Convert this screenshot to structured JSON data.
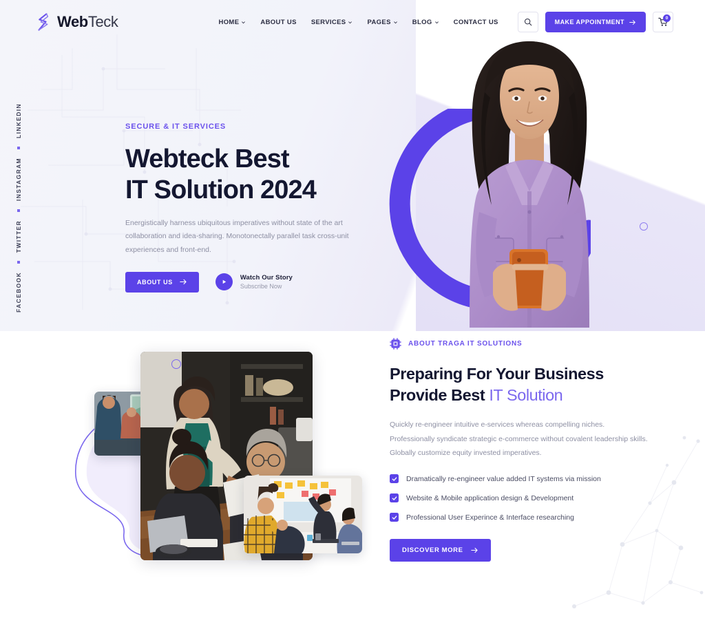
{
  "brand": {
    "name_bold": "Web",
    "name_light": "Teck",
    "logo_icon": "webteck-s-monogram"
  },
  "colors": {
    "accent": "#5b42e8",
    "accent_light": "#7b68ee",
    "heading": "#141731",
    "body_text": "#8d8fa3",
    "hero_bg": "#f4f5fa"
  },
  "header": {
    "nav_items": [
      {
        "label": "HOME",
        "has_dropdown": true
      },
      {
        "label": "ABOUT US",
        "has_dropdown": false
      },
      {
        "label": "SERVICES",
        "has_dropdown": true
      },
      {
        "label": "PAGES",
        "has_dropdown": true
      },
      {
        "label": "BLOG",
        "has_dropdown": true
      },
      {
        "label": "CONTACT US",
        "has_dropdown": false
      }
    ],
    "search_icon": "search-icon",
    "appointment_label": "MAKE APPOINTMENT",
    "cart_icon": "shopping-cart-icon",
    "cart_count": "0"
  },
  "social_rail": [
    {
      "label": "LINKEDIN"
    },
    {
      "label": "INSTAGRAM"
    },
    {
      "label": "TWITTER"
    },
    {
      "label": "FACEBOOK"
    }
  ],
  "hero": {
    "eyebrow": "SECURE & IT SERVICES",
    "title_line1": "Webteck Best",
    "title_line2": "IT Solution 2024",
    "paragraph": "Energistically harness ubiquitous imperatives without state of the art collaboration and idea-sharing. Monotonectally parallel task cross-unit experiences and front-end.",
    "primary_button": "ABOUT US",
    "video_title": "Watch Our Story",
    "video_subtitle": "Subscribe Now",
    "play_icon": "play-icon",
    "image_alt": "smiling-woman-holding-phone"
  },
  "about": {
    "eyebrow": "ABOUT TRAGA IT SOLUTIONS",
    "eyebrow_icon": "cpu-chip-icon",
    "title_line1": "Preparing For Your Business",
    "title_line2_dark": "Provide Best ",
    "title_line2_accent": "IT Solution",
    "paragraph": "Quickly re-engineer intuitive e-services whereas compelling niches. Professionally syndicate strategic e-commerce without covalent leadership skills. Globally customize equity invested imperatives.",
    "checklist": [
      {
        "label": "Dramatically re-engineer value added IT systems via mission"
      },
      {
        "label": "Website & Mobile application design & Development"
      },
      {
        "label": "Professional User Experince & Interface researching"
      }
    ],
    "cta_label": "DISCOVER MORE",
    "images": [
      {
        "alt": "team-meeting-conference-room"
      },
      {
        "alt": "open-office-coworkers"
      },
      {
        "alt": "whiteboard-workshop-session"
      }
    ]
  }
}
